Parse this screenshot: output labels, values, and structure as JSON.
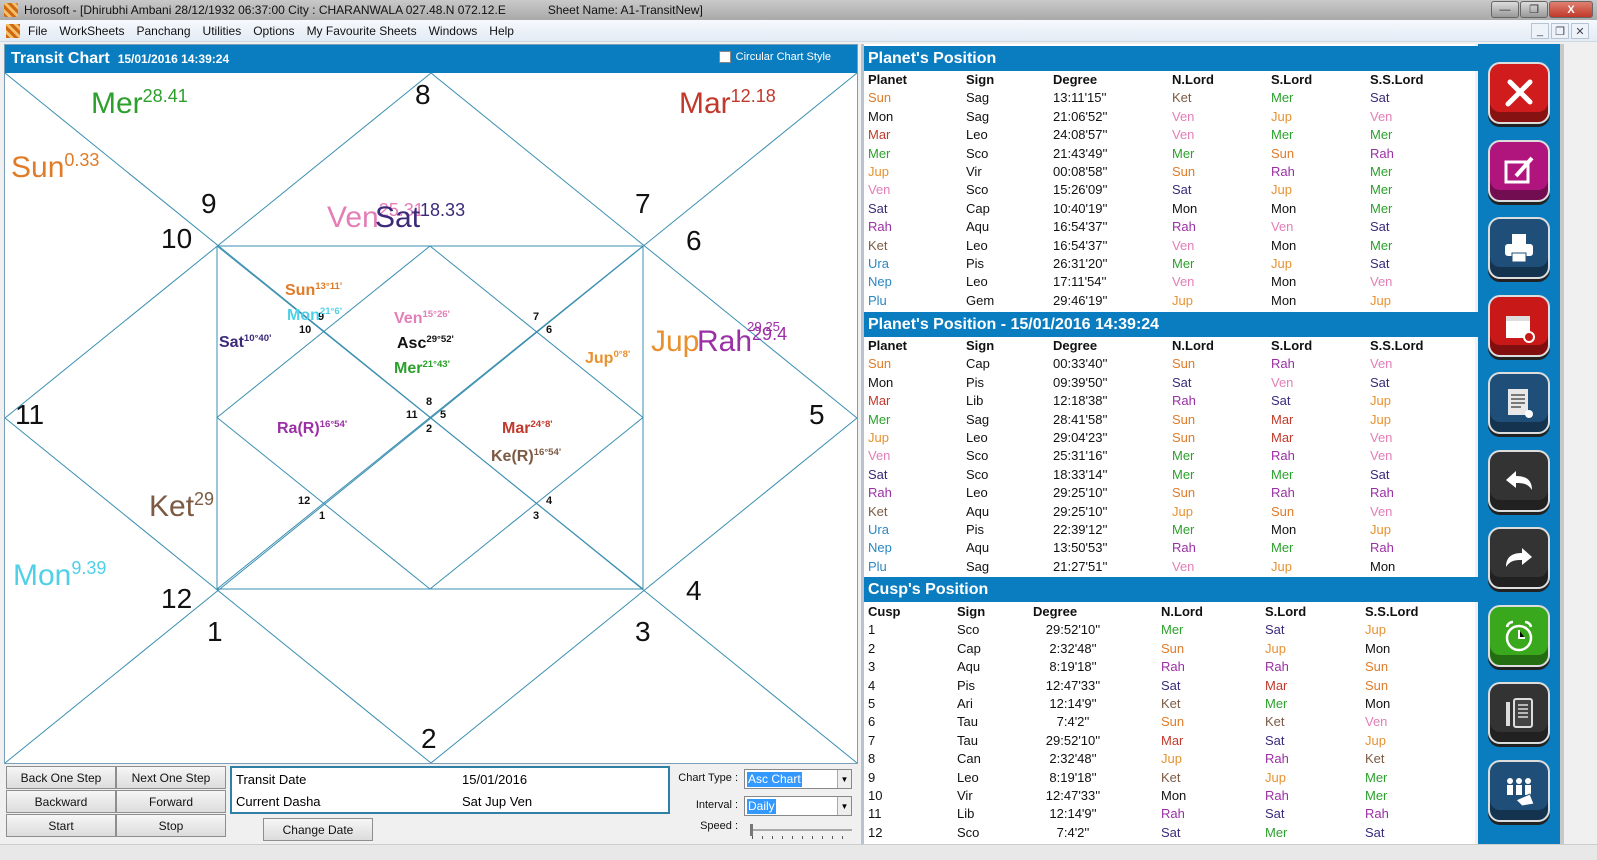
{
  "window": {
    "title": "Horosoft - [Dhirubhi Ambani 28/12/1932 06:37:00  City : CHARANWALA 027.48.N 072.12.E",
    "sheet_name": "Sheet Name: A1-TransitNew]",
    "min_label": "—",
    "max_label": "❐",
    "close_label": "X"
  },
  "menu": {
    "items": [
      "File",
      "WorkSheets",
      "Panchang",
      "Utilities",
      "Options",
      "My Favourite Sheets",
      "Windows",
      "Help"
    ],
    "mdi_min": "_",
    "mdi_restore": "❐",
    "mdi_close": "✕"
  },
  "chart": {
    "title": "Transit Chart",
    "timestamp": "15/01/2016 14:39:24",
    "circular_style_label": "Circular Chart Style",
    "circular_style_checked": false,
    "outer_house_numbers": [
      "8",
      "9",
      "7",
      "10",
      "6",
      "11",
      "5",
      "12",
      "4",
      "1",
      "3",
      "2"
    ],
    "inner_house_numbers": [
      "9",
      "10",
      "7",
      "6",
      "8",
      "11",
      "5",
      "2",
      "12",
      "1",
      "4",
      "3"
    ],
    "outer_planets": [
      {
        "name": "Mer",
        "deg": "28.41",
        "color": "#2ca02c"
      },
      {
        "name": "Mar",
        "deg": "12.18",
        "color": "#c0392b"
      },
      {
        "name": "Sun",
        "deg": "0.33",
        "color": "#e07b28"
      },
      {
        "name": "Ven",
        "deg": "25.31",
        "color": "#e37eb6"
      },
      {
        "name": "Sat",
        "deg": "18.33",
        "color": "#3b2a7a"
      },
      {
        "name": "Jup",
        "deg": "",
        "color": "#e8912f"
      },
      {
        "name": "Rah",
        "deg": "29.4",
        "color": "#9b2fa5"
      },
      {
        "name": "",
        "deg": "29.25",
        "color": "#9b2fa5"
      },
      {
        "name": "Ket",
        "deg": "29",
        "color": "#7d5a43"
      },
      {
        "name": "Mon",
        "deg": "9.39",
        "color": "#4fd0e8"
      }
    ],
    "inner_planets": [
      {
        "name": "Sun",
        "deg": "13°11'",
        "color": "#e07b28"
      },
      {
        "name": "Mon",
        "deg": "21°6'",
        "color": "#4fd0e8"
      },
      {
        "name": "Sat",
        "deg": "10°40'",
        "color": "#3b2a7a"
      },
      {
        "name": "Ven",
        "deg": "15°26'",
        "color": "#e37eb6"
      },
      {
        "name": "Asc",
        "deg": "29°52'",
        "color": "#111111"
      },
      {
        "name": "Mer",
        "deg": "21°43'",
        "color": "#2ca02c"
      },
      {
        "name": "Jup",
        "deg": "0°8'",
        "color": "#e8912f"
      },
      {
        "name": "Ra(R)",
        "deg": "16°54'",
        "color": "#9b2fa5"
      },
      {
        "name": "Mar",
        "deg": "24°8'",
        "color": "#c0392b"
      },
      {
        "name": "Ke(R)",
        "deg": "16°54'",
        "color": "#7d5a43"
      }
    ],
    "line_color": "#3a8fb0"
  },
  "controls": {
    "back_one_step": "Back One Step",
    "next_one_step": "Next One Step",
    "backward": "Backward",
    "forward": "Forward",
    "start": "Start",
    "stop": "Stop",
    "transit_date_label": "Transit Date",
    "transit_date_value": "15/01/2016",
    "current_dasha_label": "Current Dasha",
    "current_dasha_value": "Sat Jup Ven",
    "change_date": "Change Date",
    "chart_type_label": "Chart Type :",
    "chart_type_value": "Asc Chart",
    "interval_label": "Interval :",
    "interval_value": "Daily",
    "speed_label": "Speed :",
    "speed_value": 0
  },
  "colors": {
    "Sun": "#e07b28",
    "Mon": "#111111",
    "Mar": "#c0392b",
    "Mer": "#2ca02c",
    "Jup": "#e8912f",
    "Ven": "#e37eb6",
    "Sat": "#3b2a7a",
    "Rah": "#9b2fa5",
    "Ket": "#7d5a43",
    "Ura": "#2b87c2",
    "Nep": "#2b87c2",
    "Plu": "#2b87c2",
    "accent": "#0a7dc0"
  },
  "natal_positions": {
    "title": "Planet's Position",
    "headers": [
      "Planet",
      "Sign",
      "Degree",
      "N.Lord",
      "S.Lord",
      "S.S.Lord"
    ],
    "rows": [
      [
        "Sun",
        "Sag",
        "13:11'15''",
        "Ket",
        "Mer",
        "Sat"
      ],
      [
        "Mon",
        "Sag",
        "21:06'52''",
        "Ven",
        "Jup",
        "Ven"
      ],
      [
        "Mar",
        "Leo",
        "24:08'57''",
        "Ven",
        "Mer",
        "Mer"
      ],
      [
        "Mer",
        "Sco",
        "21:43'49''",
        "Mer",
        "Sun",
        "Rah"
      ],
      [
        "Jup",
        "Vir",
        "00:08'58''",
        "Sun",
        "Rah",
        "Mer"
      ],
      [
        "Ven",
        "Sco",
        "15:26'09''",
        "Sat",
        "Jup",
        "Mer"
      ],
      [
        "Sat",
        "Cap",
        "10:40'19''",
        "Mon",
        "Mon",
        "Mer"
      ],
      [
        "Rah",
        "Aqu",
        "16:54'37''",
        "Rah",
        "Ven",
        "Sat"
      ],
      [
        "Ket",
        "Leo",
        "16:54'37''",
        "Ven",
        "Mon",
        "Mer"
      ],
      [
        "Ura",
        "Pis",
        "26:31'20''",
        "Mer",
        "Jup",
        "Sat"
      ],
      [
        "Nep",
        "Leo",
        "17:11'54''",
        "Ven",
        "Mon",
        "Ven"
      ],
      [
        "Plu",
        "Gem",
        "29:46'19''",
        "Jup",
        "Mon",
        "Jup"
      ]
    ]
  },
  "transit_positions": {
    "title": "Planet's Position - 15/01/2016 14:39:24",
    "headers": [
      "Planet",
      "Sign",
      "Degree",
      "N.Lord",
      "S.Lord",
      "S.S.Lord"
    ],
    "rows": [
      [
        "Sun",
        "Cap",
        "00:33'40''",
        "Sun",
        "Rah",
        "Ven"
      ],
      [
        "Mon",
        "Pis",
        "09:39'50''",
        "Sat",
        "Ven",
        "Sat"
      ],
      [
        "Mar",
        "Lib",
        "12:18'38''",
        "Rah",
        "Sat",
        "Jup"
      ],
      [
        "Mer",
        "Sag",
        "28:41'58''",
        "Sun",
        "Mar",
        "Jup"
      ],
      [
        "Jup",
        "Leo",
        "29:04'23''",
        "Sun",
        "Mar",
        "Ven"
      ],
      [
        "Ven",
        "Sco",
        "25:31'16''",
        "Mer",
        "Rah",
        "Ven"
      ],
      [
        "Sat",
        "Sco",
        "18:33'14''",
        "Mer",
        "Mer",
        "Sat"
      ],
      [
        "Rah",
        "Leo",
        "29:25'10''",
        "Sun",
        "Rah",
        "Rah"
      ],
      [
        "Ket",
        "Aqu",
        "29:25'10''",
        "Jup",
        "Sun",
        "Ven"
      ],
      [
        "Ura",
        "Pis",
        "22:39'12''",
        "Mer",
        "Mon",
        "Jup"
      ],
      [
        "Nep",
        "Aqu",
        "13:50'53''",
        "Rah",
        "Mer",
        "Rah"
      ],
      [
        "Plu",
        "Sag",
        "21:27'51''",
        "Ven",
        "Jup",
        "Mon"
      ]
    ]
  },
  "cusp_positions": {
    "title": "Cusp's Position",
    "headers": [
      "Cusp",
      "Sign",
      "Degree",
      "N.Lord",
      "S.Lord",
      "S.S.Lord"
    ],
    "rows": [
      [
        "1",
        "Sco",
        "29:52'10''",
        "Mer",
        "Sat",
        "Jup"
      ],
      [
        "2",
        "Cap",
        "2:32'48''",
        "Sun",
        "Jup",
        "Mon"
      ],
      [
        "3",
        "Aqu",
        "8:19'18''",
        "Rah",
        "Rah",
        "Sun"
      ],
      [
        "4",
        "Pis",
        "12:47'33''",
        "Sat",
        "Mar",
        "Sun"
      ],
      [
        "5",
        "Ari",
        "12:14'9''",
        "Ket",
        "Mer",
        "Mon"
      ],
      [
        "6",
        "Tau",
        "7:4'2''",
        "Sun",
        "Ket",
        "Ven"
      ],
      [
        "7",
        "Tau",
        "29:52'10''",
        "Mar",
        "Sat",
        "Jup"
      ],
      [
        "8",
        "Can",
        "2:32'48''",
        "Jup",
        "Rah",
        "Ket"
      ],
      [
        "9",
        "Leo",
        "8:19'18''",
        "Ket",
        "Jup",
        "Mer"
      ],
      [
        "10",
        "Vir",
        "12:47'33''",
        "Mon",
        "Rah",
        "Mer"
      ],
      [
        "11",
        "Lib",
        "12:14'9''",
        "Rah",
        "Sat",
        "Rah"
      ],
      [
        "12",
        "Sco",
        "7:4'2''",
        "Sat",
        "Mer",
        "Sat"
      ]
    ]
  },
  "toolbar": {
    "buttons": [
      {
        "icon": "tools-icon",
        "color": "#d01c1c"
      },
      {
        "icon": "edit-icon",
        "color": "#b0157e"
      },
      {
        "icon": "print-icon",
        "color": "#1f4f78"
      },
      {
        "icon": "calendar-icon",
        "color": "#c81818"
      },
      {
        "icon": "document-pointer-icon",
        "color": "#1f4f78"
      },
      {
        "icon": "back-arrow-icon",
        "color": "#333333"
      },
      {
        "icon": "forward-arrow-icon",
        "color": "#333333"
      },
      {
        "icon": "alarm-clock-icon",
        "color": "#3aa81c"
      },
      {
        "icon": "notebook-icon",
        "color": "#333333"
      },
      {
        "icon": "group-select-icon",
        "color": "#1f4f78"
      }
    ]
  }
}
